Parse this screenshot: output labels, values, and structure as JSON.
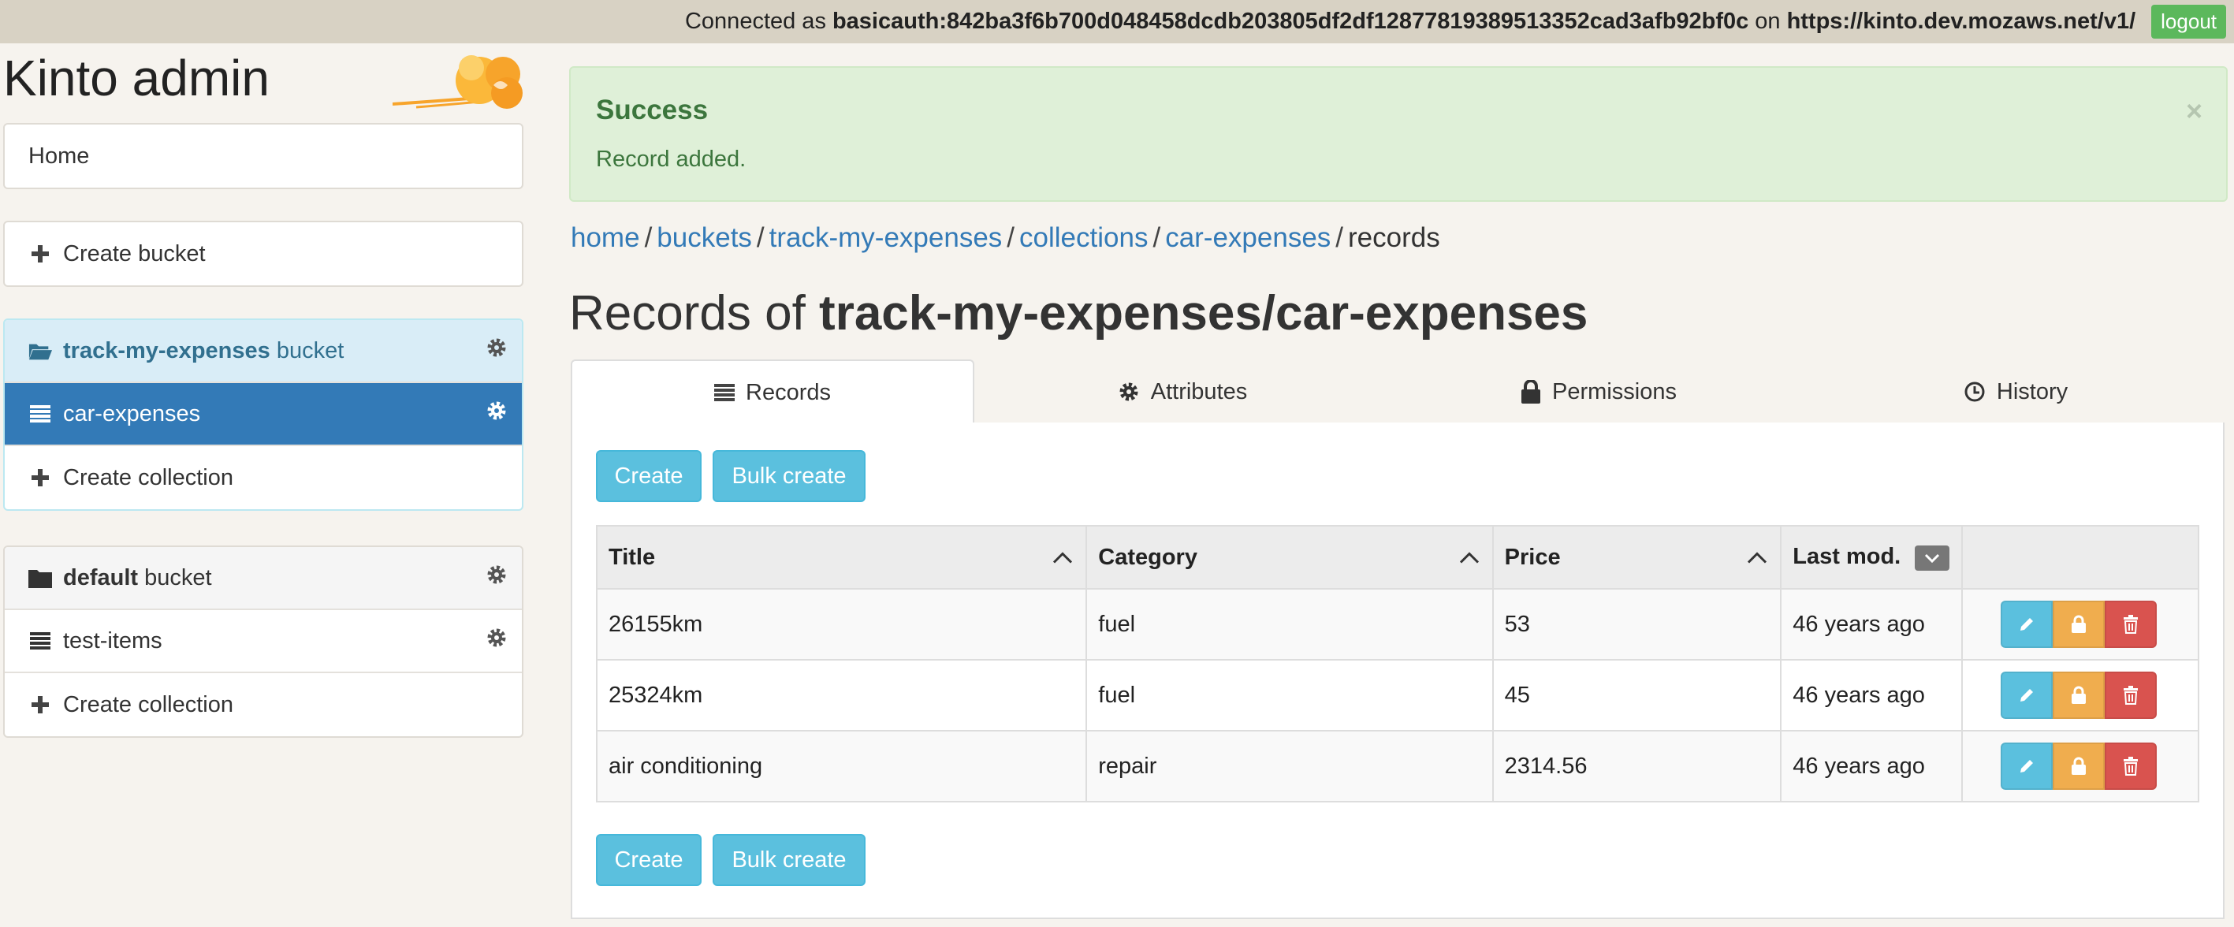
{
  "topbar": {
    "connected_prefix": "Connected as",
    "user": "basicauth:842ba3f6b700d048458dcdb203805df2df12877819389513352cad3afb92bf0c",
    "on": "on",
    "server": "https://kinto.dev.mozaws.net/v1/",
    "logout_label": "logout"
  },
  "sidebar": {
    "brand": "Kinto admin",
    "home_label": "Home",
    "create_bucket_label": "Create bucket",
    "buckets": [
      {
        "name": "track-my-expenses",
        "suffix": "bucket",
        "collections": [
          {
            "name": "car-expenses"
          }
        ],
        "create_collection_label": "Create collection"
      },
      {
        "name": "default",
        "suffix": "bucket",
        "collections": [
          {
            "name": "test-items"
          }
        ],
        "create_collection_label": "Create collection"
      }
    ]
  },
  "alert": {
    "title": "Success",
    "message": "Record added.",
    "close": "×"
  },
  "breadcrumb": {
    "items": [
      "home",
      "buckets",
      "track-my-expenses",
      "collections",
      "car-expenses"
    ],
    "current": "records",
    "separator": "/"
  },
  "page": {
    "title_prefix": "Records of",
    "title_path": "track-my-expenses/car-expenses"
  },
  "tabs": [
    {
      "label": "Records",
      "icon": "list-icon"
    },
    {
      "label": "Attributes",
      "icon": "gear-icon"
    },
    {
      "label": "Permissions",
      "icon": "lock-icon"
    },
    {
      "label": "History",
      "icon": "clock-icon"
    }
  ],
  "buttons": {
    "create_label": "Create",
    "bulk_create_label": "Bulk create"
  },
  "table": {
    "columns": [
      "Title",
      "Category",
      "Price",
      "Last mod."
    ],
    "rows": [
      {
        "title": "26155km",
        "category": "fuel",
        "price": "53",
        "last_mod": "46 years ago"
      },
      {
        "title": "25324km",
        "category": "fuel",
        "price": "45",
        "last_mod": "46 years ago"
      },
      {
        "title": "air conditioning",
        "category": "repair",
        "price": "2314.56",
        "last_mod": "46 years ago"
      }
    ]
  },
  "colors": {
    "accent": "#337ab7",
    "success_bg": "#dff0d8",
    "info_button": "#5bc0de",
    "warning_button": "#f0ad4e",
    "danger_button": "#d9534f",
    "logout_button": "#5cb85c"
  }
}
